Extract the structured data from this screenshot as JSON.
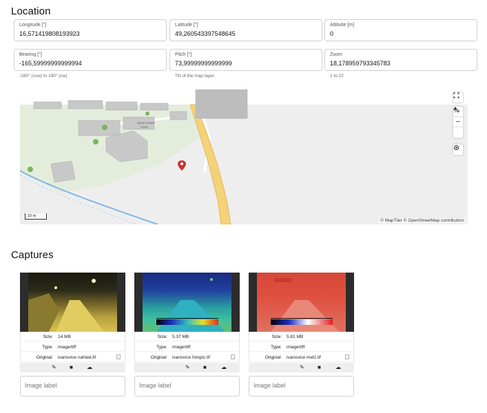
{
  "location": {
    "title": "Location",
    "fields": {
      "longitude": {
        "label": "Longitude [°]",
        "value": "16,571419808193923"
      },
      "latitude": {
        "label": "Latitude [°]",
        "value": "49,260543397548645"
      },
      "altitude": {
        "label": "Altitude [m]",
        "value": "0"
      },
      "bearing": {
        "label": "Bearing [°]",
        "value": "-165,59999999999994",
        "hint": "-180° (ccw) to 180° (cw)"
      },
      "pitch": {
        "label": "Pitch [°]",
        "value": "73,99999999999999",
        "hint": "Tilt of the map layer."
      },
      "zoom": {
        "label": "Zoom",
        "value": "18,178959793345783",
        "hint": "1 to 22"
      }
    }
  },
  "map": {
    "attribution": "© MapTiler © OpenStreetMap contributors",
    "scale_label": "10 m",
    "place_label_1": "Sport Center",
    "place_label_2": "Areal",
    "controls": {
      "fullscreen_icon": "fullscreen-icon",
      "zoom_in": "+",
      "zoom_out": "−",
      "compass_icon": "compass-icon",
      "geolocate_icon": "crosshair-icon"
    },
    "colors": {
      "road": "#f4d27a",
      "road_edge": "#e6b84c",
      "water": "#7fb6e8",
      "park": "#e4eddc",
      "building": "#c8c8c8"
    }
  },
  "captures": {
    "title": "Captures",
    "keys": {
      "size": "Size:",
      "type": "Type:",
      "original": "Original:"
    },
    "label_placeholder": "Image label",
    "items": [
      {
        "size": "14 MB",
        "type": "image/tiff",
        "original": "ivanovice nahled.tif"
      },
      {
        "size": "5.37 MB",
        "type": "image/tiff",
        "original": "ivanovice fotopic.tif"
      },
      {
        "size": "5.81 MB",
        "type": "image/tiff",
        "original": "ivanovice mel2.tif"
      }
    ]
  }
}
